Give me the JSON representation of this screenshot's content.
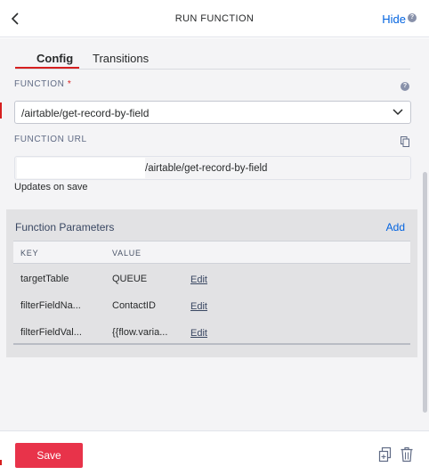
{
  "header": {
    "title": "RUN FUNCTION",
    "hide_label": "Hide",
    "help_glyph": "?"
  },
  "tabs": [
    {
      "label": "Config",
      "active": true
    },
    {
      "label": "Transitions",
      "active": false
    }
  ],
  "function": {
    "label": "FUNCTION",
    "required_mark": "*",
    "selected_value": "/airtable/get-record-by-field",
    "help_glyph": "?"
  },
  "function_url": {
    "label": "FUNCTION URL",
    "path": "/airtable/get-record-by-field",
    "note": "Updates on save"
  },
  "parameters": {
    "title": "Function Parameters",
    "add_label": "Add",
    "columns": {
      "key": "KEY",
      "value": "VALUE"
    },
    "edit_label": "Edit",
    "rows": [
      {
        "key": "targetTable",
        "value": "QUEUE"
      },
      {
        "key": "filterFieldNa...",
        "value": "ContactID"
      },
      {
        "key": "filterFieldVal...",
        "value": "{{flow.varia..."
      }
    ]
  },
  "footer": {
    "save_label": "Save"
  },
  "icons": {
    "back": "chevron-left-icon",
    "select": "chevron-down-icon",
    "copy": "copy-icon",
    "duplicate": "duplicate-icon",
    "delete": "trash-icon"
  },
  "colors": {
    "accent_link": "#0263e0",
    "save_button": "#e8334a",
    "active_tab_underline": "#d61f1f"
  }
}
